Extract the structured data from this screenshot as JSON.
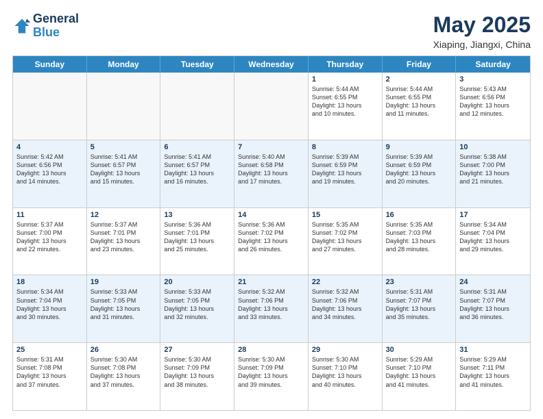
{
  "logo": {
    "line1": "General",
    "line2": "Blue"
  },
  "title": "May 2025",
  "location": "Xiaping, Jiangxi, China",
  "weekdays": [
    "Sunday",
    "Monday",
    "Tuesday",
    "Wednesday",
    "Thursday",
    "Friday",
    "Saturday"
  ],
  "rows": [
    {
      "alt": false,
      "cells": [
        {
          "day": "",
          "text": ""
        },
        {
          "day": "",
          "text": ""
        },
        {
          "day": "",
          "text": ""
        },
        {
          "day": "",
          "text": ""
        },
        {
          "day": "1",
          "text": "Sunrise: 5:44 AM\nSunset: 6:55 PM\nDaylight: 13 hours\nand 10 minutes."
        },
        {
          "day": "2",
          "text": "Sunrise: 5:44 AM\nSunset: 6:55 PM\nDaylight: 13 hours\nand 11 minutes."
        },
        {
          "day": "3",
          "text": "Sunrise: 5:43 AM\nSunset: 6:56 PM\nDaylight: 13 hours\nand 12 minutes."
        }
      ]
    },
    {
      "alt": true,
      "cells": [
        {
          "day": "4",
          "text": "Sunrise: 5:42 AM\nSunset: 6:56 PM\nDaylight: 13 hours\nand 14 minutes."
        },
        {
          "day": "5",
          "text": "Sunrise: 5:41 AM\nSunset: 6:57 PM\nDaylight: 13 hours\nand 15 minutes."
        },
        {
          "day": "6",
          "text": "Sunrise: 5:41 AM\nSunset: 6:57 PM\nDaylight: 13 hours\nand 16 minutes."
        },
        {
          "day": "7",
          "text": "Sunrise: 5:40 AM\nSunset: 6:58 PM\nDaylight: 13 hours\nand 17 minutes."
        },
        {
          "day": "8",
          "text": "Sunrise: 5:39 AM\nSunset: 6:59 PM\nDaylight: 13 hours\nand 19 minutes."
        },
        {
          "day": "9",
          "text": "Sunrise: 5:39 AM\nSunset: 6:59 PM\nDaylight: 13 hours\nand 20 minutes."
        },
        {
          "day": "10",
          "text": "Sunrise: 5:38 AM\nSunset: 7:00 PM\nDaylight: 13 hours\nand 21 minutes."
        }
      ]
    },
    {
      "alt": false,
      "cells": [
        {
          "day": "11",
          "text": "Sunrise: 5:37 AM\nSunset: 7:00 PM\nDaylight: 13 hours\nand 22 minutes."
        },
        {
          "day": "12",
          "text": "Sunrise: 5:37 AM\nSunset: 7:01 PM\nDaylight: 13 hours\nand 23 minutes."
        },
        {
          "day": "13",
          "text": "Sunrise: 5:36 AM\nSunset: 7:01 PM\nDaylight: 13 hours\nand 25 minutes."
        },
        {
          "day": "14",
          "text": "Sunrise: 5:36 AM\nSunset: 7:02 PM\nDaylight: 13 hours\nand 26 minutes."
        },
        {
          "day": "15",
          "text": "Sunrise: 5:35 AM\nSunset: 7:02 PM\nDaylight: 13 hours\nand 27 minutes."
        },
        {
          "day": "16",
          "text": "Sunrise: 5:35 AM\nSunset: 7:03 PM\nDaylight: 13 hours\nand 28 minutes."
        },
        {
          "day": "17",
          "text": "Sunrise: 5:34 AM\nSunset: 7:04 PM\nDaylight: 13 hours\nand 29 minutes."
        }
      ]
    },
    {
      "alt": true,
      "cells": [
        {
          "day": "18",
          "text": "Sunrise: 5:34 AM\nSunset: 7:04 PM\nDaylight: 13 hours\nand 30 minutes."
        },
        {
          "day": "19",
          "text": "Sunrise: 5:33 AM\nSunset: 7:05 PM\nDaylight: 13 hours\nand 31 minutes."
        },
        {
          "day": "20",
          "text": "Sunrise: 5:33 AM\nSunset: 7:05 PM\nDaylight: 13 hours\nand 32 minutes."
        },
        {
          "day": "21",
          "text": "Sunrise: 5:32 AM\nSunset: 7:06 PM\nDaylight: 13 hours\nand 33 minutes."
        },
        {
          "day": "22",
          "text": "Sunrise: 5:32 AM\nSunset: 7:06 PM\nDaylight: 13 hours\nand 34 minutes."
        },
        {
          "day": "23",
          "text": "Sunrise: 5:31 AM\nSunset: 7:07 PM\nDaylight: 13 hours\nand 35 minutes."
        },
        {
          "day": "24",
          "text": "Sunrise: 5:31 AM\nSunset: 7:07 PM\nDaylight: 13 hours\nand 36 minutes."
        }
      ]
    },
    {
      "alt": false,
      "cells": [
        {
          "day": "25",
          "text": "Sunrise: 5:31 AM\nSunset: 7:08 PM\nDaylight: 13 hours\nand 37 minutes."
        },
        {
          "day": "26",
          "text": "Sunrise: 5:30 AM\nSunset: 7:08 PM\nDaylight: 13 hours\nand 37 minutes."
        },
        {
          "day": "27",
          "text": "Sunrise: 5:30 AM\nSunset: 7:09 PM\nDaylight: 13 hours\nand 38 minutes."
        },
        {
          "day": "28",
          "text": "Sunrise: 5:30 AM\nSunset: 7:09 PM\nDaylight: 13 hours\nand 39 minutes."
        },
        {
          "day": "29",
          "text": "Sunrise: 5:30 AM\nSunset: 7:10 PM\nDaylight: 13 hours\nand 40 minutes."
        },
        {
          "day": "30",
          "text": "Sunrise: 5:29 AM\nSunset: 7:10 PM\nDaylight: 13 hours\nand 41 minutes."
        },
        {
          "day": "31",
          "text": "Sunrise: 5:29 AM\nSunset: 7:11 PM\nDaylight: 13 hours\nand 41 minutes."
        }
      ]
    }
  ]
}
